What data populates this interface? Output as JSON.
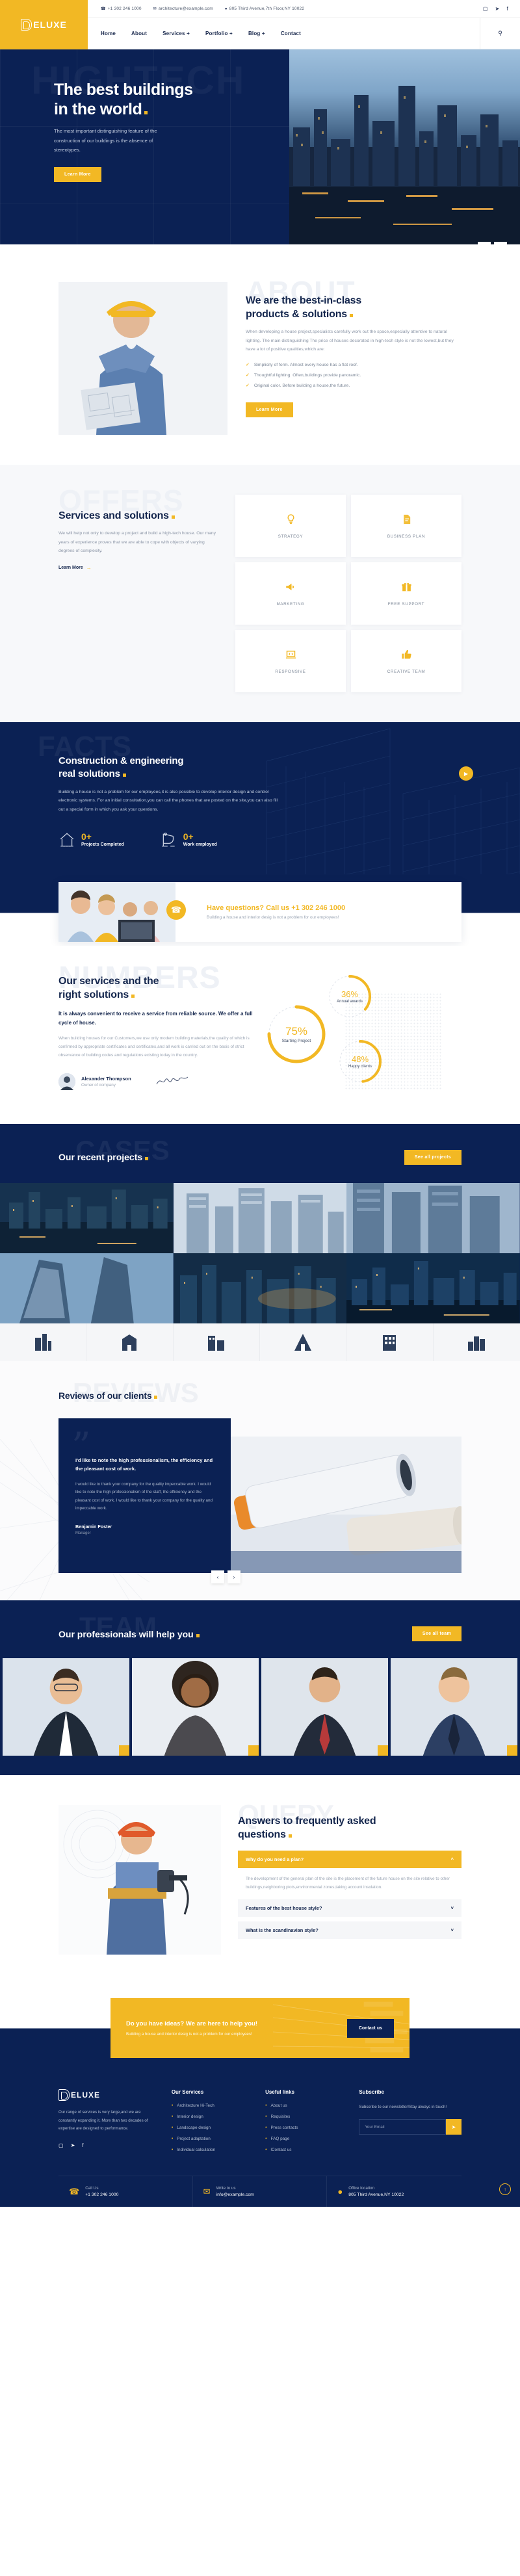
{
  "brand": {
    "name": "ELUXE",
    "logo_icon": "deluxe-logo-icon"
  },
  "topbar": {
    "phone": "+1 302 246 1000",
    "email": "architecture@example.com",
    "address": "805 Third Avenue,7th Floor,NY 10022",
    "phone_icon": "phone-icon",
    "email_icon": "envelope-icon",
    "address_icon": "map-pin-icon",
    "social": [
      {
        "name": "instagram-icon",
        "glyph": "▢"
      },
      {
        "name": "twitter-icon",
        "glyph": "✉"
      },
      {
        "name": "facebook-icon",
        "glyph": "f"
      }
    ]
  },
  "nav": {
    "items": [
      "Home",
      "About",
      "Services +",
      "Portfolio +",
      "Blog +",
      "Contact"
    ],
    "search_icon": "search-icon"
  },
  "hero": {
    "ghost": "HIGHTECH",
    "title_line1": "The best buildings",
    "title_line2": "in the world",
    "text": "The most important distinguishing feature of the construction of our buildings is the absence of stereotypes.",
    "cta": "Learn More",
    "prev_icon": "chevron-left-icon",
    "next_icon": "chevron-right-icon"
  },
  "about": {
    "ghost": "ABOUT",
    "title_line1": "We are the best-in-class",
    "title_line2": "products & solutions",
    "text": "When developing a house project,specialists carefully work out the space,especially attentive to natural lighting. The main distinguishing The price of houses decorated in high-tech style is not the lowest,but they have a lot of positive qualities,which are:",
    "bullets": [
      "Simplicity of form. Almost every house has a flat roof.",
      "Thoughtful lighting. Often,buildings provide panoramic.",
      "Original color. Before building a house,the future."
    ],
    "cta": "Learn More"
  },
  "services": {
    "ghost": "OFFERS",
    "title": "Services and solutions",
    "text": "We will help not only to develop a project and build a high-tech house. Our many years of experience proves that we are able to cope with objects of varying degrees of complexity.",
    "link": "Learn More",
    "cards": [
      {
        "icon": "lightbulb-icon",
        "glyph": "Ὂ1",
        "label": "STRATEGY"
      },
      {
        "icon": "document-icon",
        "glyph": "Ὄ4",
        "label": "BUSINESS PLAN"
      },
      {
        "icon": "megaphone-icon",
        "glyph": "὎2",
        "label": "MARKETING"
      },
      {
        "icon": "gift-icon",
        "glyph": "Ἰ1",
        "label": "FREE SUPPORT"
      },
      {
        "icon": "laptop-code-icon",
        "glyph": "Ὃb",
        "label": "RESPONSIVE"
      },
      {
        "icon": "thumbs-up-icon",
        "glyph": "ὄd",
        "label": "CREATIVE TEAM"
      }
    ]
  },
  "facts": {
    "ghost": "FACTS",
    "title_line1": "Construction & engineering",
    "title_line2": "real solutions",
    "text": "Building a house is not a problem for our employees,it is also possible to develop interior design and control electronic systems. For an initial consultation,you can call the phones that are posted on the site,you can also fill out a special form in which you ask your questions.",
    "counters": [
      {
        "icon": "house-outline-icon",
        "value": "0+",
        "label": "Projects Completed"
      },
      {
        "icon": "crane-outline-icon",
        "value": "0+",
        "label": "Work employed"
      }
    ]
  },
  "call_card": {
    "heading": "Have questions? Call us",
    "phone": "+1 302 246 1000",
    "sub": "Building a house and interior desig is not a problem for our employees!",
    "icon": "phone-ring-icon"
  },
  "numbers": {
    "ghost": "NUMBERS",
    "title_line1": "Our services and the",
    "title_line2": "right solutions",
    "lead": "It is always convenient to receive a service from reliable source. We offer a full cycle of house.",
    "text": "When building houses for our Customers,we use only modern building materials,the quality of which is confirmed by appropriate certificates and certificates,and all work is carried out on the basis of strict observance of building codes and regulations existing today in the country.",
    "owner_name": "Alexander Thompson",
    "owner_role": "Owner of company",
    "signature": "A.Th",
    "rings": [
      {
        "value": "75%",
        "label": "Starting Project",
        "pct": 75
      },
      {
        "value": "36%",
        "label": "Annual awards",
        "pct": 36
      },
      {
        "value": "48%",
        "label": "Happy clients",
        "pct": 48
      }
    ]
  },
  "cases": {
    "ghost": "CASES",
    "title": "Our recent projects",
    "cta": "See all projects",
    "projects": [
      {
        "name": "project-tile-1"
      },
      {
        "name": "project-tile-2"
      },
      {
        "name": "project-tile-3"
      },
      {
        "name": "project-tile-4"
      },
      {
        "name": "project-tile-5"
      },
      {
        "name": "project-tile-6"
      }
    ],
    "logos": [
      "building-logo-1",
      "building-logo-2",
      "building-logo-3",
      "building-logo-4",
      "building-logo-5",
      "building-logo-6"
    ]
  },
  "reviews": {
    "ghost": "REVIEWS",
    "title": "Reviews of our clients",
    "quote": "I'd like to note the high professionalism, the efficiency and the pleasant cost of work.",
    "text": "I would like to thank your company for the quality impeccable work. I would like to note the high professionalism of the staff, the efficiency and the pleasant cost of work. I would like to thank your company for the quality and impeccable work.",
    "author": "Benjamin Foster",
    "role": "Manager",
    "prev_icon": "chevron-left-icon",
    "next_icon": "chevron-right-icon"
  },
  "team": {
    "ghost": "TEAM",
    "title": "Our professionals will help you",
    "cta": "See all team",
    "members": [
      {
        "name": "team-member-1"
      },
      {
        "name": "team-member-2"
      },
      {
        "name": "team-member-3"
      },
      {
        "name": "team-member-4"
      }
    ]
  },
  "faq": {
    "ghost": "QUERY",
    "title_line1": "Answers to frequently asked",
    "title_line2": "questions",
    "items": [
      {
        "q": "Why do you need a plan?",
        "a": "The development of the general plan of the site is the placement of the future house on the site relative to other buildings,neighboring plots,environmental zones,taking account insolation.",
        "open": true
      },
      {
        "q": "Features of the best house style?",
        "a": "",
        "open": false
      },
      {
        "q": "What is the scandinavian style?",
        "a": "",
        "open": false
      }
    ],
    "chevron_open": "chevron-up-icon",
    "chevron_closed": "chevron-down-icon"
  },
  "cta": {
    "heading": "Do you have ideas? We are here to help you!",
    "sub": "Building a house and interior desig is not a problem for our employees!",
    "button": "Contact us"
  },
  "footer": {
    "about": "Our range of services is very large,and we are constantly expanding it. More than two decades of expertise are designed to performance.",
    "social": [
      {
        "name": "instagram-icon",
        "glyph": "▢"
      },
      {
        "name": "twitter-icon",
        "glyph": "✉"
      },
      {
        "name": "facebook-icon",
        "glyph": "f"
      }
    ],
    "services_title": "Our Services",
    "services": [
      "Architecture Hi-Tech",
      "Interior design",
      "Landscape design",
      "Project adaptation",
      "Individual calculation"
    ],
    "links_title": "Useful links",
    "links": [
      "About us",
      "Requisites",
      "Press contacts",
      "FAQ page",
      "lContact us"
    ],
    "sub_title": "Subscribe",
    "sub_text": "Subscribe to our newsletter!Stay always in touch!",
    "sub_placeholder": "Your Email",
    "sub_btn_icon": "send-icon",
    "contacts": [
      {
        "icon": "phone-icon",
        "label": "Call Us",
        "value": "+1 302 246 1000"
      },
      {
        "icon": "envelope-icon",
        "label": "Write to us",
        "value": "info@example.com"
      },
      {
        "icon": "map-pin-icon",
        "label": "Office location",
        "value": "805 Third Avenue,NY 10022"
      }
    ],
    "to_top_icon": "arrow-up-icon"
  },
  "colors": {
    "accent": "#f2b824",
    "navy": "#0b2154",
    "dark_text": "#14264d"
  }
}
